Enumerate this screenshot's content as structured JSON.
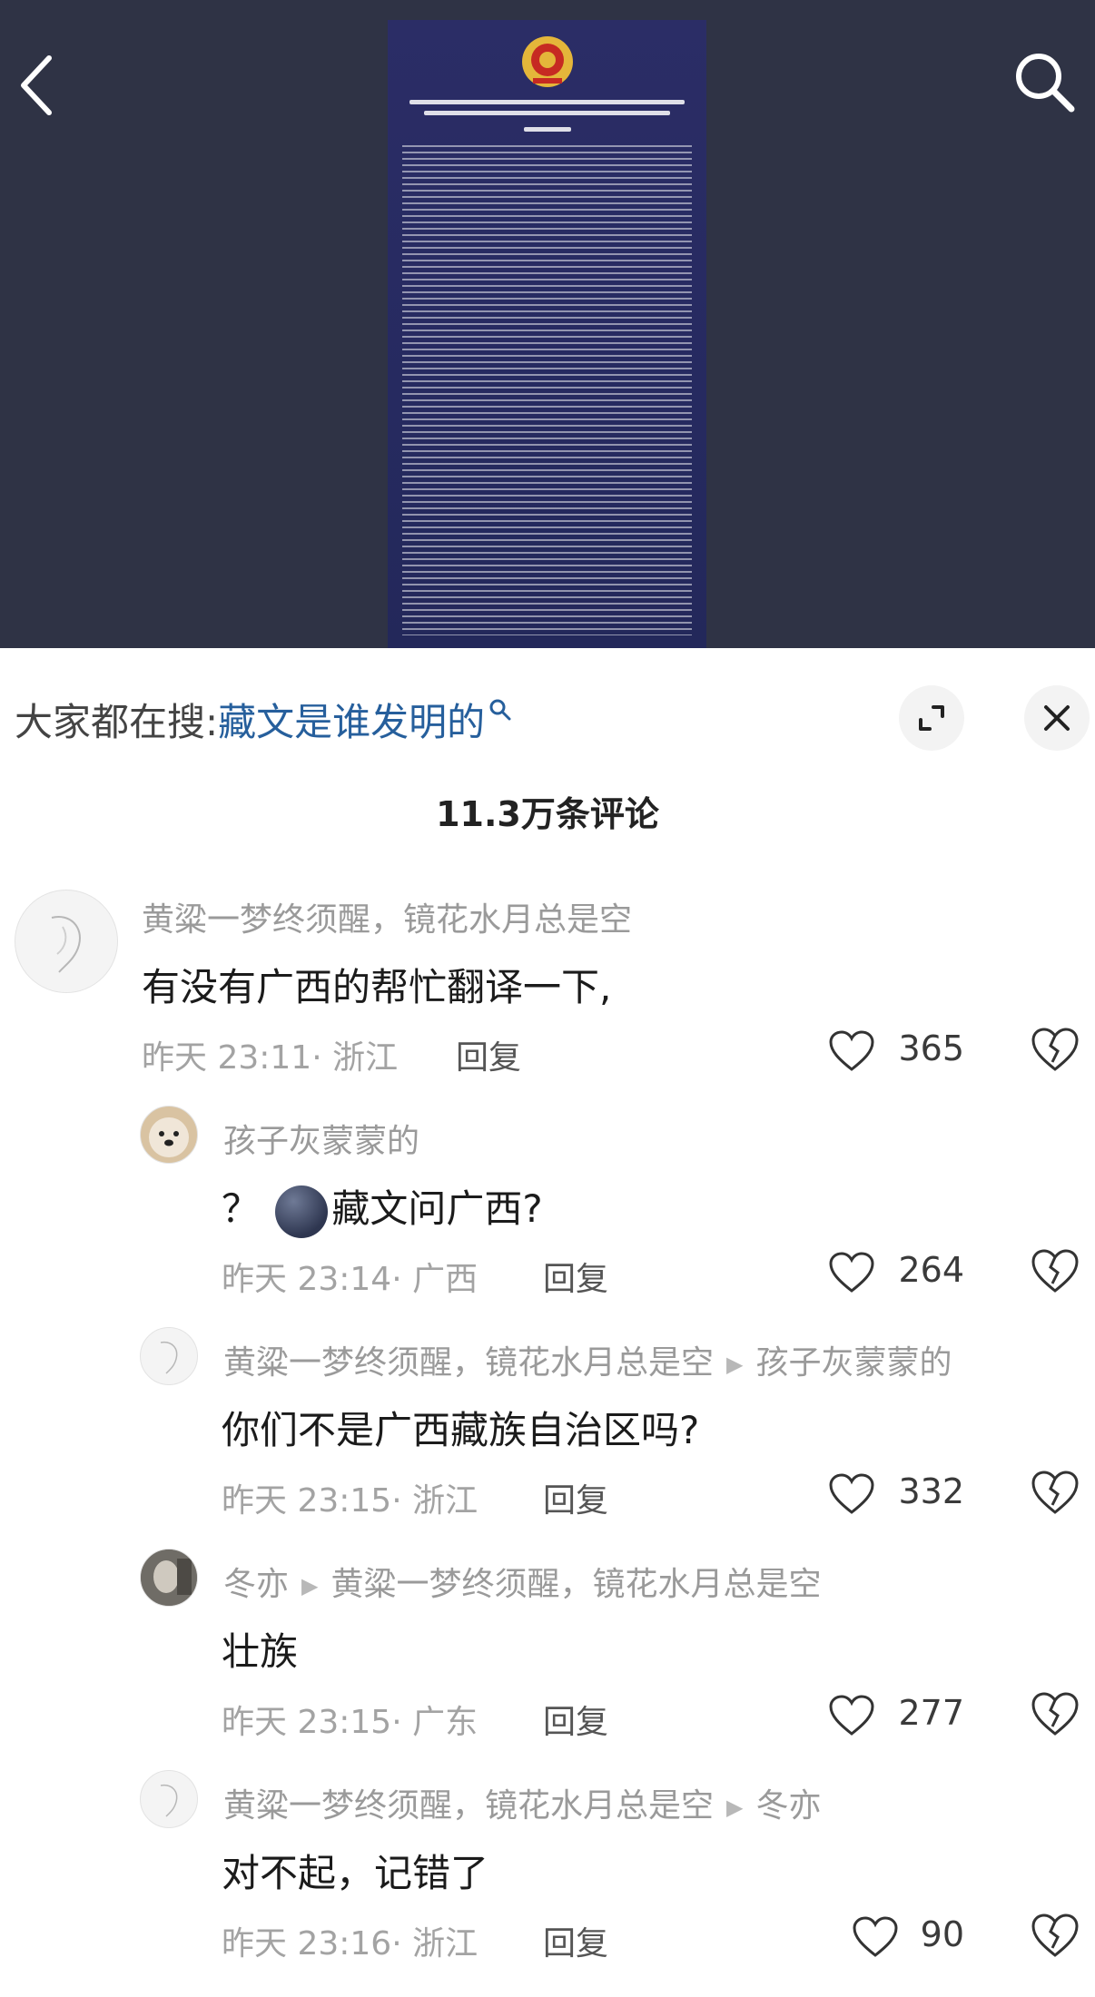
{
  "header": {
    "back_icon": "chevron-left-icon",
    "search_icon": "search-icon"
  },
  "post_image": {
    "emblem_icon": "police-emblem-icon"
  },
  "suggestion": {
    "prefix": "大家都在搜:",
    "query": "藏文是谁发明的",
    "query_icon": "search-icon",
    "expand_icon": "expand-icon",
    "close_icon": "close-icon"
  },
  "comments_header": {
    "count": "11.3万条评论"
  },
  "comments": [
    {
      "user": "黄粱一梦终须醒，镜花水月总是空",
      "reply_to": "",
      "text": "有没有广西的帮忙翻译一下,",
      "time": "昨天 23:11",
      "location": "· 浙江",
      "reply_label": "回复",
      "likes": "365"
    },
    {
      "user": "孩子灰蒙蒙的",
      "reply_to": "",
      "text_prefix": "？",
      "emoji": "dark-moon-emoji",
      "text": "藏文问广西?",
      "time": "昨天 23:14",
      "location": "· 广西",
      "reply_label": "回复",
      "likes": "264"
    },
    {
      "user": "黄粱一梦终须醒，镜花水月总是空",
      "reply_to": "孩子灰蒙蒙的",
      "text": "你们不是广西藏族自治区吗?",
      "time": "昨天 23:15",
      "location": "· 浙江",
      "reply_label": "回复",
      "likes": "332"
    },
    {
      "user": "冬亦",
      "reply_to": "黄粱一梦终须醒，镜花水月总是空",
      "text": "壮族",
      "time": "昨天 23:15",
      "location": "· 广东",
      "reply_label": "回复",
      "likes": "277"
    },
    {
      "user": "黄粱一梦终须醒，镜花水月总是空",
      "reply_to": "冬亦",
      "text": "对不起，记错了",
      "time": "昨天 23:16",
      "location": "· 浙江",
      "reply_label": "回复",
      "likes": "90"
    }
  ],
  "colors": {
    "link": "#265f9c",
    "header_bg": "#2f3345",
    "doc_bg": "#262a60"
  }
}
